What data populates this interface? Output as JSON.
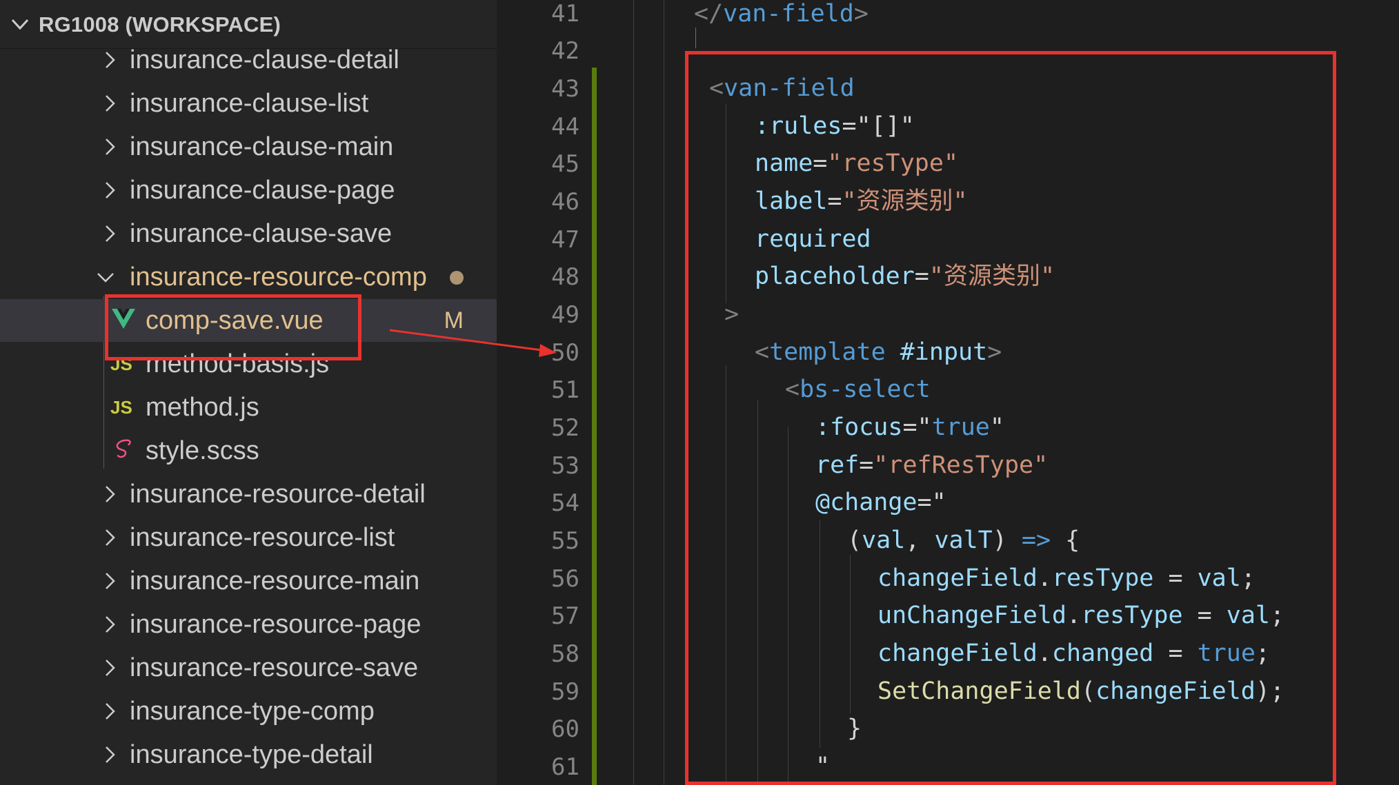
{
  "workspace": {
    "title": "RG1008 (WORKSPACE)"
  },
  "explorer": {
    "folders_top": [
      "insurance-clause-detail",
      "insurance-clause-list",
      "insurance-clause-main",
      "insurance-clause-page",
      "insurance-clause-save"
    ],
    "open_folder": "insurance-resource-comp",
    "files": [
      {
        "name": "comp-save.vue",
        "icon": "vue-icon",
        "status": "M"
      },
      {
        "name": "method-basis.js",
        "icon": "js-icon",
        "icon_text": "JS"
      },
      {
        "name": "method.js",
        "icon": "js-icon",
        "icon_text": "JS"
      },
      {
        "name": "style.scss",
        "icon": "sass-icon"
      }
    ],
    "folders_bottom": [
      "insurance-resource-detail",
      "insurance-resource-list",
      "insurance-resource-main",
      "insurance-resource-page",
      "insurance-resource-save",
      "insurance-type-comp",
      "insurance-type-detail"
    ]
  },
  "editor": {
    "line_numbers": [
      "41",
      "42",
      "43",
      "44",
      "45",
      "46",
      "47",
      "48",
      "49",
      "50",
      "51",
      "52",
      "53",
      "54",
      "55",
      "56",
      "57",
      "58",
      "59",
      "60",
      "61"
    ]
  },
  "colors": {
    "annotation": "#e8322e",
    "git_modified": "#587c0c",
    "tag": "#569cd6",
    "attribute": "#9cdcfe",
    "string": "#ce9178",
    "function": "#dcdcaa"
  }
}
